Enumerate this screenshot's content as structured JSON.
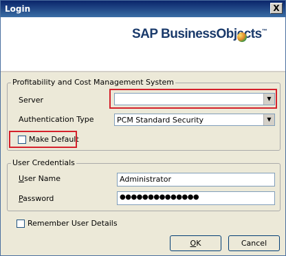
{
  "window": {
    "title": "Login",
    "close_glyph": "X"
  },
  "brand": {
    "logo_text": "SAP BusinessObjects",
    "trademark": "™",
    "logo_icon": "businessobjects-ball-icon"
  },
  "system_group": {
    "title": "Profitability and Cost Management System",
    "server_label": "Server",
    "server_value": "",
    "auth_label": "Authentication Type",
    "auth_value": "PCM Standard Security",
    "make_default_label": "Make Default"
  },
  "credentials_group": {
    "title": "User Credentials",
    "user_label": "User Name",
    "user_value": "Administrator",
    "password_label": "Password",
    "password_mask": "●●●●●●●●●●●●●●"
  },
  "remember_label": "Remember User Details",
  "buttons": {
    "ok": "OK",
    "cancel": "Cancel"
  },
  "colors": {
    "highlight": "#d4202a",
    "title_bar": "#0a246a",
    "face": "#ece9d8"
  }
}
